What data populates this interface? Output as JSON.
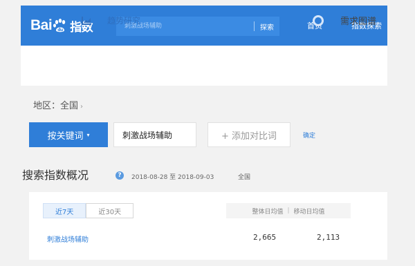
{
  "header": {
    "logo_bai": "Bai",
    "logo_suffix": "指数",
    "search_placeholder": "刺激战场辅助",
    "search_button": "探索",
    "nav_home": "首页",
    "nav_explore": "指数探索"
  },
  "subnav": {
    "trend_label": "趋势研究",
    "demand_label": "需求图谱"
  },
  "filters": {
    "region_label": "地区：全国",
    "region_arrow": "›",
    "keyword_button": "按关键词",
    "keyword_caret": "▾",
    "keyword_value": "刺激战场辅助",
    "add_compare": "+ 添加对比词",
    "confirm": "确定"
  },
  "overview": {
    "title": "搜索指数概况",
    "help": "?",
    "date_range": "2018-08-28 至 2018-09-03",
    "region": "全国",
    "tabs": [
      {
        "label": "近7天",
        "active": true
      },
      {
        "label": "近30天",
        "active": false
      }
    ],
    "col_overall": "整体日均值",
    "col_sep": "|",
    "col_mobile": "移动日均值",
    "row": {
      "keyword": "刺激战场辅助",
      "overall": "2,665",
      "mobile": "2,113"
    }
  },
  "colors": {
    "brand_blue": "#2f7ed8",
    "link_blue": "#2f7ed8",
    "background": "#f2f2f2"
  }
}
